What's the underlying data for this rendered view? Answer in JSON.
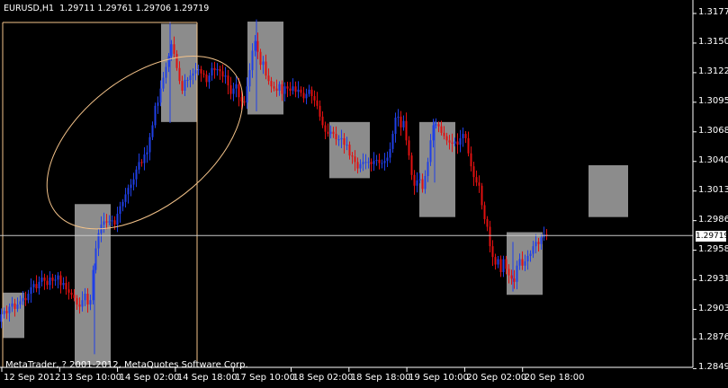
{
  "header": {
    "symbol": "EURUSD,H1",
    "ohlc": "1.29711 1.29761 1.29706 1.29719"
  },
  "footer": {
    "copyright": "MetaTrader, ? 2001-2012, MetaQuotes Software Corp."
  },
  "price_axis": {
    "labels": [
      "1.31775",
      "1.31500",
      "1.31225",
      "1.30955",
      "1.30680",
      "1.30405",
      "1.30130",
      "1.29860",
      "1.29585",
      "1.29310",
      "1.29035",
      "1.28765",
      "1.28490"
    ],
    "current": "1.29719"
  },
  "time_axis": {
    "labels": [
      "12 Sep 2012",
      "13 Sep 10:00",
      "14 Sep 02:00",
      "14 Sep 18:00",
      "17 Sep 10:00",
      "18 Sep 02:00",
      "18 Sep 18:00",
      "19 Sep 10:00",
      "20 Sep 02:00",
      "20 Sep 18:00"
    ]
  },
  "colors": {
    "background": "#000000",
    "bull": "#1f3fe6",
    "bear": "#e01010",
    "box": "#8c8c8c",
    "ellipse": "#f4c38a",
    "grid": "#ffffff"
  },
  "chart_data": {
    "type": "candlestick",
    "symbol": "EURUSD",
    "timeframe": "H1",
    "ylim": [
      1.2849,
      1.3185
    ],
    "current_price": 1.29719,
    "path": [
      [
        0,
        1.2892
      ],
      [
        3,
        1.2899
      ],
      [
        6,
        1.2902
      ],
      [
        9,
        1.29
      ],
      [
        12,
        1.2906
      ],
      [
        15,
        1.2909
      ],
      [
        18,
        1.2904
      ],
      [
        21,
        1.2908
      ],
      [
        24,
        1.2911
      ],
      [
        27,
        1.2914
      ],
      [
        30,
        1.2912
      ],
      [
        33,
        1.2918
      ],
      [
        36,
        1.2924
      ],
      [
        39,
        1.2927
      ],
      [
        42,
        1.2923
      ],
      [
        45,
        1.2929
      ],
      [
        48,
        1.2933
      ],
      [
        51,
        1.293
      ],
      [
        54,
        1.2926
      ],
      [
        57,
        1.2933
      ],
      [
        60,
        1.293
      ],
      [
        63,
        1.2931
      ],
      [
        66,
        1.2935
      ],
      [
        69,
        1.2926
      ],
      [
        72,
        1.2928
      ],
      [
        75,
        1.2922
      ],
      [
        78,
        1.2919
      ],
      [
        81,
        1.2917
      ],
      [
        84,
        1.2914
      ],
      [
        87,
        1.2908
      ],
      [
        90,
        1.2906
      ],
      [
        93,
        1.2912
      ],
      [
        96,
        1.2918
      ],
      [
        99,
        1.2908
      ],
      [
        102,
        1.2912
      ],
      [
        105,
        1.294
      ],
      [
        108,
        1.296
      ],
      [
        111,
        1.2974
      ],
      [
        114,
        1.2982
      ],
      [
        117,
        1.2985
      ],
      [
        120,
        1.2984
      ],
      [
        123,
        1.2985
      ],
      [
        126,
        1.2986
      ],
      [
        129,
        1.2982
      ],
      [
        132,
        1.2992
      ],
      [
        135,
        1.2999
      ],
      [
        138,
        1.3003
      ],
      [
        141,
        1.301
      ],
      [
        144,
        1.3016
      ],
      [
        147,
        1.3019
      ],
      [
        150,
        1.3024
      ],
      [
        153,
        1.3033
      ],
      [
        156,
        1.304
      ],
      [
        159,
        1.3039
      ],
      [
        162,
        1.3047
      ],
      [
        165,
        1.3049
      ],
      [
        168,
        1.3063
      ],
      [
        171,
        1.3074
      ],
      [
        174,
        1.3092
      ],
      [
        177,
        1.3095
      ],
      [
        180,
        1.3108
      ],
      [
        183,
        1.3118
      ],
      [
        186,
        1.3128
      ],
      [
        189,
        1.3138
      ],
      [
        192,
        1.3149
      ],
      [
        195,
        1.314
      ],
      [
        198,
        1.3127
      ],
      [
        201,
        1.3115
      ],
      [
        204,
        1.3106
      ],
      [
        207,
        1.3116
      ],
      [
        210,
        1.3116
      ],
      [
        213,
        1.312
      ],
      [
        216,
        1.3122
      ],
      [
        219,
        1.3125
      ],
      [
        222,
        1.3126
      ],
      [
        225,
        1.3122
      ],
      [
        228,
        1.3121
      ],
      [
        231,
        1.3114
      ],
      [
        234,
        1.312
      ],
      [
        237,
        1.3127
      ],
      [
        240,
        1.3125
      ],
      [
        243,
        1.3126
      ],
      [
        246,
        1.3124
      ],
      [
        249,
        1.3119
      ],
      [
        252,
        1.312
      ],
      [
        255,
        1.3111
      ],
      [
        258,
        1.3103
      ],
      [
        261,
        1.3108
      ],
      [
        264,
        1.3112
      ],
      [
        267,
        1.31
      ],
      [
        270,
        1.3096
      ],
      [
        273,
        1.3095
      ],
      [
        276,
        1.311
      ],
      [
        279,
        1.3125
      ],
      [
        282,
        1.3143
      ],
      [
        285,
        1.3152
      ],
      [
        288,
        1.3142
      ],
      [
        291,
        1.313
      ],
      [
        294,
        1.3133
      ],
      [
        297,
        1.312
      ],
      [
        300,
        1.3115
      ],
      [
        303,
        1.311
      ],
      [
        306,
        1.3108
      ],
      [
        309,
        1.3106
      ],
      [
        312,
        1.3112
      ],
      [
        315,
        1.3103
      ],
      [
        318,
        1.311
      ],
      [
        321,
        1.3108
      ],
      [
        324,
        1.3106
      ],
      [
        327,
        1.311
      ],
      [
        330,
        1.3105
      ],
      [
        333,
        1.3107
      ],
      [
        336,
        1.3104
      ],
      [
        339,
        1.3099
      ],
      [
        342,
        1.3103
      ],
      [
        345,
        1.3107
      ],
      [
        348,
        1.3101
      ],
      [
        351,
        1.3097
      ],
      [
        354,
        1.3092
      ],
      [
        357,
        1.3082
      ],
      [
        360,
        1.3074
      ],
      [
        363,
        1.3068
      ],
      [
        366,
        1.3066
      ],
      [
        369,
        1.3068
      ],
      [
        372,
        1.3066
      ],
      [
        375,
        1.3061
      ],
      [
        378,
        1.3061
      ],
      [
        381,
        1.3062
      ],
      [
        384,
        1.3056
      ],
      [
        387,
        1.3056
      ],
      [
        390,
        1.3046
      ],
      [
        393,
        1.3045
      ],
      [
        396,
        1.304
      ],
      [
        399,
        1.3034
      ],
      [
        402,
        1.3038
      ],
      [
        405,
        1.304
      ],
      [
        408,
        1.304
      ],
      [
        411,
        1.304
      ],
      [
        414,
        1.3038
      ],
      [
        417,
        1.3041
      ],
      [
        420,
        1.3042
      ],
      [
        423,
        1.3039
      ],
      [
        426,
        1.3039
      ],
      [
        429,
        1.3041
      ],
      [
        432,
        1.3044
      ],
      [
        435,
        1.3052
      ],
      [
        438,
        1.3066
      ],
      [
        441,
        1.3081
      ],
      [
        444,
        1.3082
      ],
      [
        447,
        1.3072
      ],
      [
        450,
        1.3078
      ],
      [
        453,
        1.306
      ],
      [
        456,
        1.3046
      ],
      [
        459,
        1.3028
      ],
      [
        462,
        1.3018
      ],
      [
        465,
        1.3023
      ],
      [
        468,
        1.3024
      ],
      [
        471,
        1.3015
      ],
      [
        474,
        1.3027
      ],
      [
        477,
        1.304
      ],
      [
        480,
        1.306
      ],
      [
        483,
        1.3074
      ],
      [
        486,
        1.3075
      ],
      [
        489,
        1.3073
      ],
      [
        492,
        1.3067
      ],
      [
        495,
        1.3064
      ],
      [
        498,
        1.306
      ],
      [
        501,
        1.3058
      ],
      [
        504,
        1.3057
      ],
      [
        507,
        1.3059
      ],
      [
        510,
        1.3056
      ],
      [
        513,
        1.3062
      ],
      [
        516,
        1.3066
      ],
      [
        519,
        1.3062
      ],
      [
        522,
        1.3048
      ],
      [
        525,
        1.3036
      ],
      [
        528,
        1.3026
      ],
      [
        531,
        1.3021
      ],
      [
        534,
        1.3018
      ],
      [
        537,
        1.3
      ],
      [
        540,
        1.2987
      ],
      [
        543,
        1.298
      ],
      [
        546,
        1.2962
      ],
      [
        549,
        1.2952
      ],
      [
        552,
        1.2945
      ],
      [
        555,
        1.295
      ],
      [
        558,
        1.2938
      ],
      [
        561,
        1.295
      ],
      [
        564,
        1.2941
      ],
      [
        567,
        1.2935
      ],
      [
        570,
        1.2932
      ],
      [
        573,
        1.2929
      ],
      [
        576,
        1.2944
      ],
      [
        579,
        1.295
      ],
      [
        582,
        1.2944
      ],
      [
        585,
        1.2948
      ],
      [
        588,
        1.2953
      ],
      [
        591,
        1.2955
      ],
      [
        594,
        1.2962
      ],
      [
        597,
        1.2966
      ],
      [
        600,
        1.2964
      ],
      [
        603,
        1.297
      ],
      [
        606,
        1.2973
      ],
      [
        609,
        1.29719
      ]
    ],
    "spikes": [
      {
        "x": 105,
        "low": 1.2862,
        "high": 1.2946
      },
      {
        "x": 189,
        "low": 1.3076,
        "high": 1.317
      },
      {
        "x": 285,
        "low": 1.3087,
        "high": 1.3172
      },
      {
        "x": 483,
        "low": 1.3021,
        "high": 1.3078
      },
      {
        "x": 570,
        "low": 1.292,
        "high": 1.2966
      }
    ],
    "boxes": [
      {
        "x0": 3,
        "x1": 27,
        "top": 1.2919,
        "bottom": 1.2877
      },
      {
        "x0": 83,
        "x1": 123,
        "top": 1.3001,
        "bottom": 1.2852
      },
      {
        "x0": 179,
        "x1": 219,
        "top": 1.3168,
        "bottom": 1.3077
      },
      {
        "x0": 275,
        "x1": 315,
        "top": 1.317,
        "bottom": 1.3084
      },
      {
        "x0": 366,
        "x1": 411,
        "top": 1.3077,
        "bottom": 1.3025
      },
      {
        "x0": 466,
        "x1": 506,
        "top": 1.3077,
        "bottom": 1.2989
      },
      {
        "x0": 563,
        "x1": 603,
        "top": 1.2975,
        "bottom": 1.2917
      },
      {
        "x0": 654,
        "x1": 698,
        "top": 1.3037,
        "bottom": 1.2989
      }
    ],
    "crosshair": {
      "x_time_index": 219,
      "price": 1.29719
    },
    "ellipse": {
      "cx_index": 161,
      "cy_price": 1.3058,
      "rx_index": 126,
      "ry_price": 0.006,
      "rotation_deg": -38
    }
  }
}
